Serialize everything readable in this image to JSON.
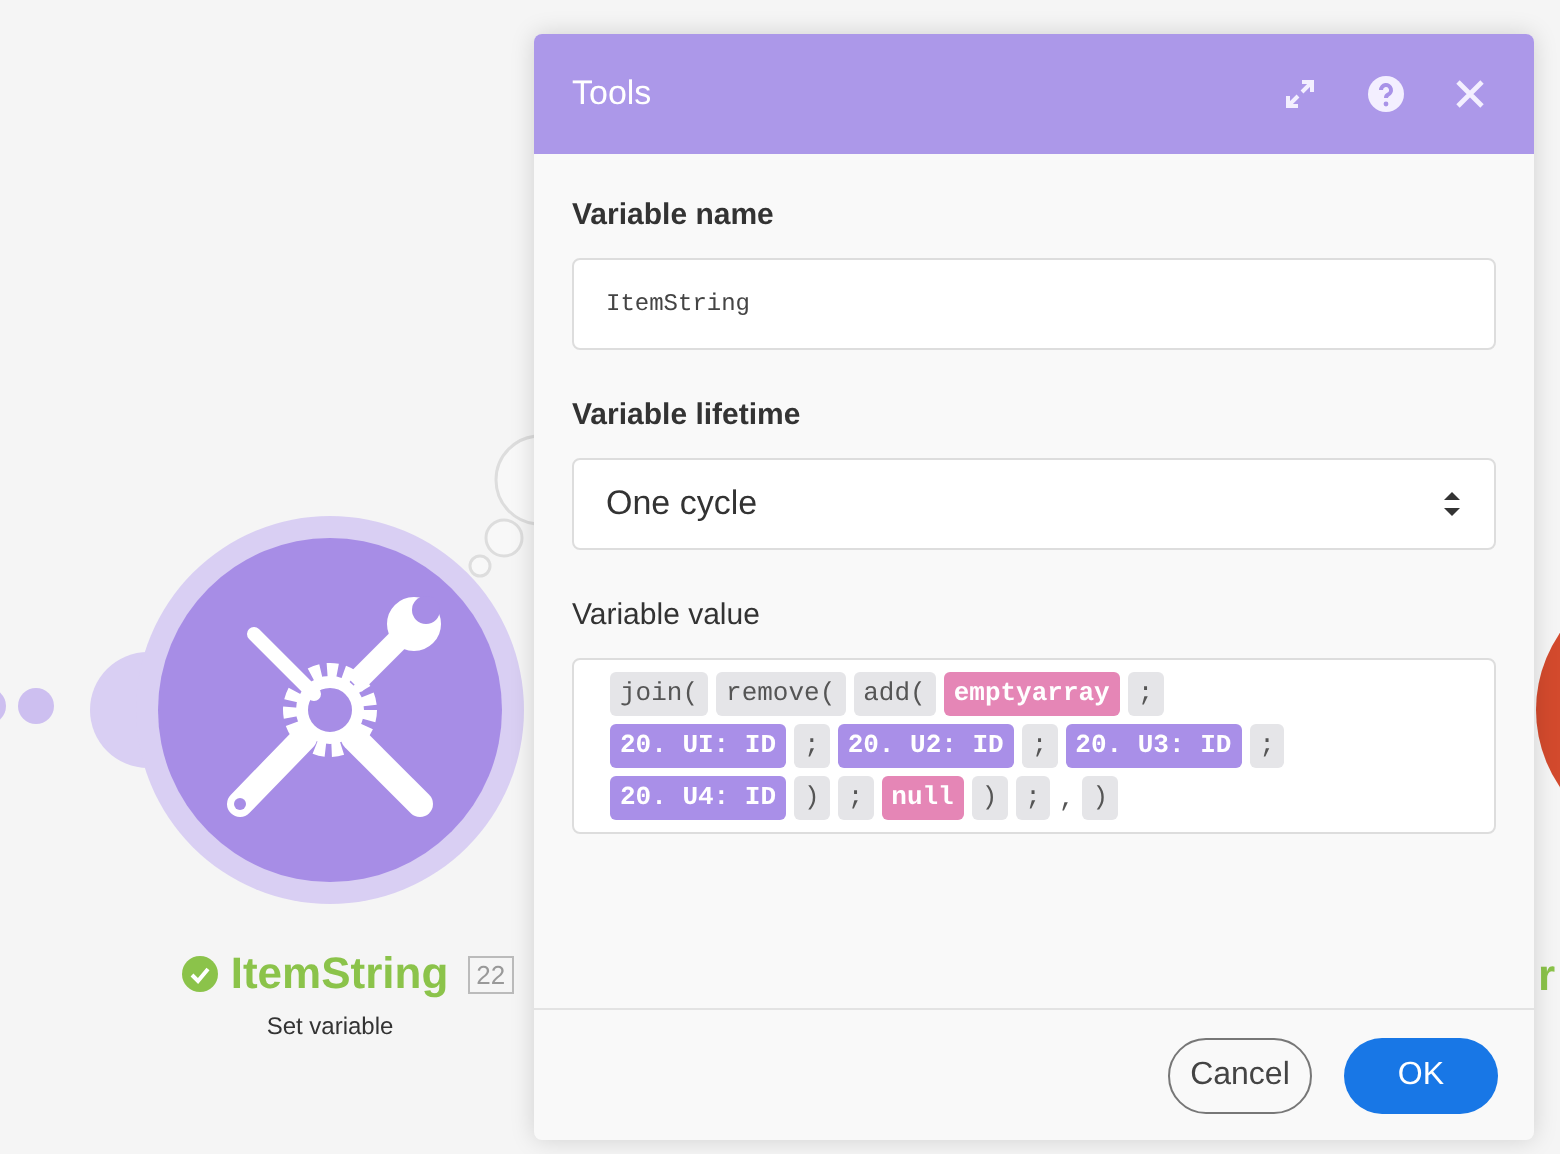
{
  "canvas": {
    "module": {
      "title": "ItemString",
      "number": "22",
      "subtitle": "Set variable"
    },
    "next_module": {
      "title_partial": "r"
    }
  },
  "dialog": {
    "title": "Tools",
    "fields": [
      {
        "kind": "text",
        "label": "Variable name",
        "value": "ItemString"
      },
      {
        "kind": "select",
        "label": "Variable lifetime",
        "value": "One cycle"
      },
      {
        "kind": "formula",
        "label": "Variable value",
        "lines": [
          [
            {
              "kind": "function",
              "text": "join("
            },
            {
              "kind": "function",
              "text": "remove("
            },
            {
              "kind": "function",
              "text": "add("
            },
            {
              "kind": "keyword",
              "text": "emptyarray"
            },
            {
              "kind": "function",
              "text": ";"
            }
          ],
          [
            {
              "kind": "variable",
              "text": "20. UI: ID"
            },
            {
              "kind": "function",
              "text": ";"
            },
            {
              "kind": "variable",
              "text": "20. U2: ID"
            },
            {
              "kind": "function",
              "text": ";"
            },
            {
              "kind": "variable",
              "text": "20. U3: ID"
            },
            {
              "kind": "function",
              "text": ";"
            }
          ],
          [
            {
              "kind": "variable",
              "text": "20. U4: ID"
            },
            {
              "kind": "function",
              "text": ")"
            },
            {
              "kind": "function",
              "text": ";"
            },
            {
              "kind": "keyword",
              "text": "null"
            },
            {
              "kind": "function",
              "text": ")"
            },
            {
              "kind": "function",
              "text": ";"
            },
            {
              "kind": "plain",
              "text": ","
            },
            {
              "kind": "function",
              "text": ")"
            }
          ]
        ]
      }
    ],
    "buttons": [
      {
        "kind": "secondary",
        "label": "Cancel"
      },
      {
        "kind": "primary",
        "label": "OK"
      }
    ]
  }
}
